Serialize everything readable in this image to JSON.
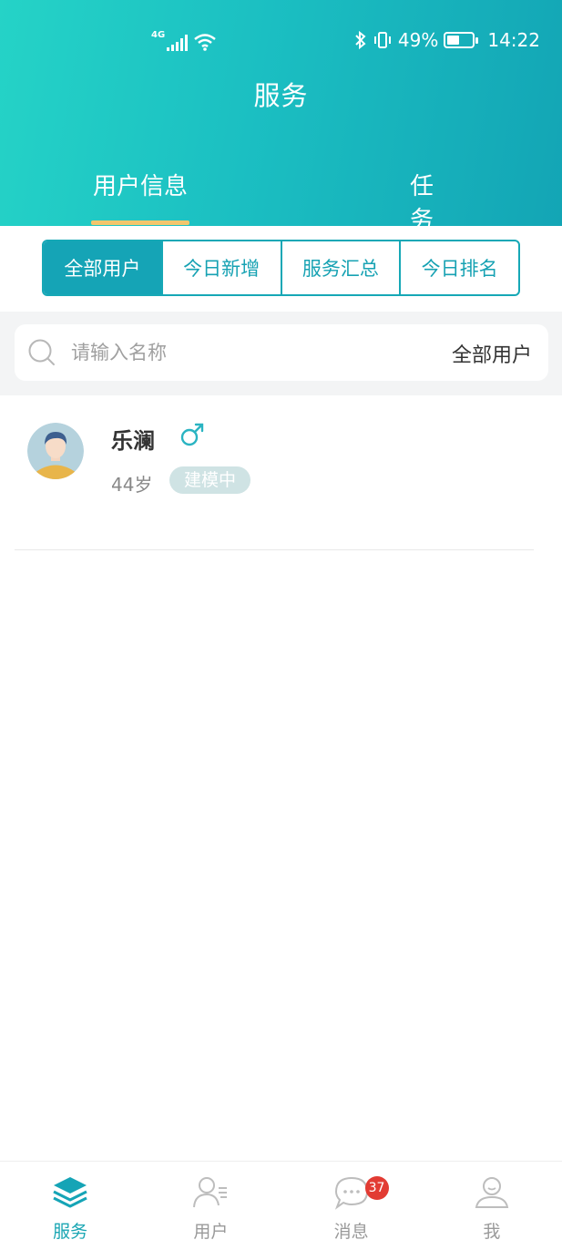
{
  "status_bar": {
    "network": "4G",
    "battery": "49%",
    "battery_level": 0.49,
    "time": "14:22"
  },
  "header": {
    "title": "服务",
    "tabs": [
      {
        "label": "用户信息",
        "active": true
      },
      {
        "label": "任务",
        "active": false
      }
    ]
  },
  "filters": [
    {
      "label": "全部用户",
      "active": true
    },
    {
      "label": "今日新增",
      "active": false
    },
    {
      "label": "服务汇总",
      "active": false
    },
    {
      "label": "今日排名",
      "active": false
    }
  ],
  "search": {
    "placeholder": "请输入名称",
    "value": "",
    "filter_label": "全部用户"
  },
  "users": [
    {
      "name": "乐澜",
      "gender": "male",
      "age": "44岁",
      "status": "建模中"
    }
  ],
  "bottom_nav": [
    {
      "label": "服务",
      "icon": "layers-icon",
      "active": true
    },
    {
      "label": "用户",
      "icon": "user-list-icon",
      "active": false
    },
    {
      "label": "消息",
      "icon": "chat-icon",
      "active": false,
      "badge": "37"
    },
    {
      "label": "我",
      "icon": "profile-icon",
      "active": false
    }
  ],
  "colors": {
    "accent": "#15a4b6",
    "header_start": "#25d3c7",
    "header_end": "#13a5b5",
    "tab_indicator": "#f2c66d",
    "badge_red": "#e23b33"
  }
}
